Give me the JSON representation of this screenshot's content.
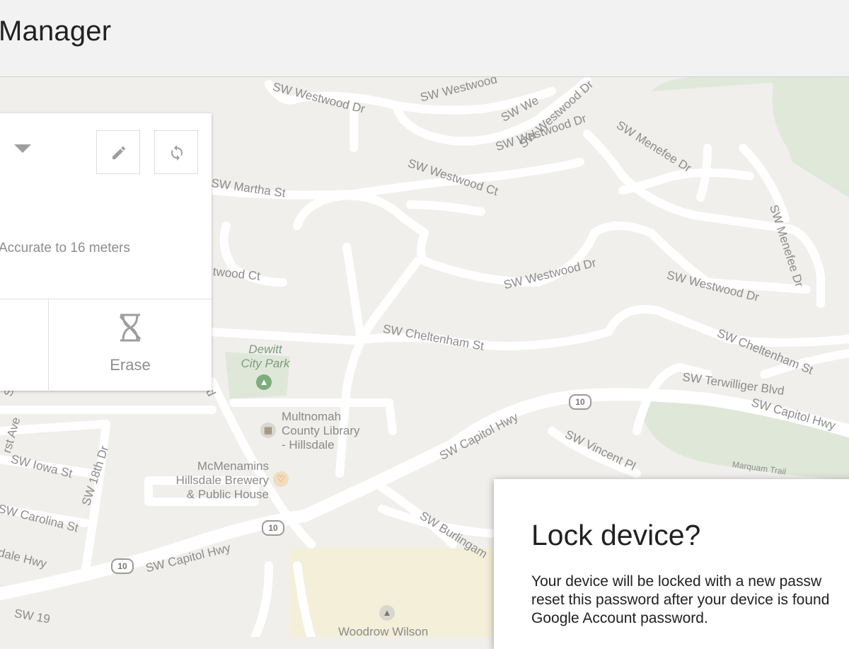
{
  "header": {
    "title": "Manager"
  },
  "device_card": {
    "edit_icon": "pencil-icon",
    "refresh_icon": "refresh-icon",
    "accuracy_text": "Accurate to 16 meters",
    "actions": {
      "erase_label": "Erase"
    }
  },
  "map": {
    "streets": [
      "SW Westwood Dr",
      "SW Westwood",
      "SW We",
      "SW Westwood Dr",
      "SW Westwood Dr",
      "SW Menefee Dr",
      "SW Westwood Ct",
      "SW Martha St",
      "twood Ct",
      "SW Menefee Dr",
      "SW Westwood Dr",
      "SW Westwood Dr",
      "SW Cheltenham St",
      "SW Cheltenham St",
      "SW Terwilliger Blvd",
      "SW Capitol Hwy",
      "SW Capitol Hwy",
      "SW Capitol Hwy",
      "SW Vincent Pl",
      "Marquam Trail",
      "SW Burlingam",
      "SW Iowa St",
      "SW 18th Dr",
      "SW Carolina St",
      "dale Hwy",
      "rst Ave",
      "St",
      "Blvd",
      "SW 19"
    ],
    "places": {
      "park_line1": "Dewitt",
      "park_line2": "City Park",
      "library_line1": "Multnomah",
      "library_line2": "County Library",
      "library_line3": "- Hillsdale",
      "brewery_line1": "McMenamins",
      "brewery_line2": "Hillsdale Brewery",
      "brewery_line3": "& Public House",
      "school": "Woodrow Wilson"
    },
    "highway_badges": [
      "10",
      "10",
      "10"
    ]
  },
  "dialog": {
    "title": "Lock device?",
    "body_lines": [
      "Your device will be locked with a new passw",
      "reset this password after your device is found",
      "Google Account password."
    ]
  }
}
